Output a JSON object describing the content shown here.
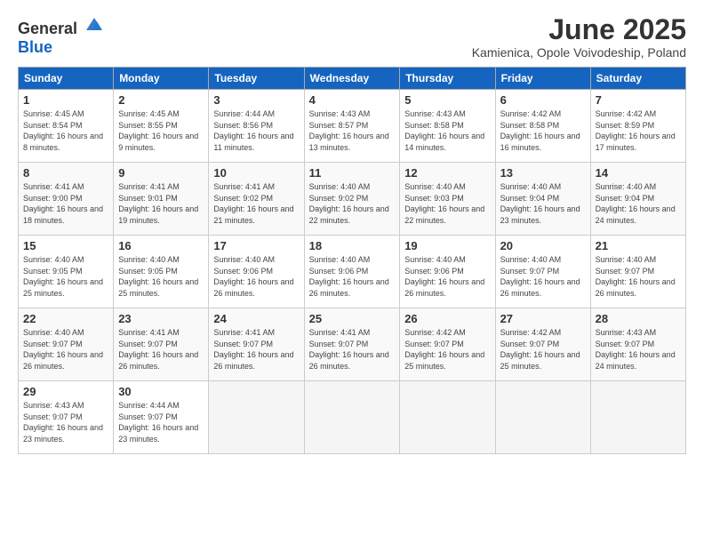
{
  "logo": {
    "general": "General",
    "blue": "Blue"
  },
  "header": {
    "month": "June 2025",
    "location": "Kamienica, Opole Voivodeship, Poland"
  },
  "weekdays": [
    "Sunday",
    "Monday",
    "Tuesday",
    "Wednesday",
    "Thursday",
    "Friday",
    "Saturday"
  ],
  "weeks": [
    [
      {
        "day": "1",
        "sunrise": "4:45 AM",
        "sunset": "8:54 PM",
        "daylight": "16 hours and 8 minutes."
      },
      {
        "day": "2",
        "sunrise": "4:45 AM",
        "sunset": "8:55 PM",
        "daylight": "16 hours and 9 minutes."
      },
      {
        "day": "3",
        "sunrise": "4:44 AM",
        "sunset": "8:56 PM",
        "daylight": "16 hours and 11 minutes."
      },
      {
        "day": "4",
        "sunrise": "4:43 AM",
        "sunset": "8:57 PM",
        "daylight": "16 hours and 13 minutes."
      },
      {
        "day": "5",
        "sunrise": "4:43 AM",
        "sunset": "8:58 PM",
        "daylight": "16 hours and 14 minutes."
      },
      {
        "day": "6",
        "sunrise": "4:42 AM",
        "sunset": "8:58 PM",
        "daylight": "16 hours and 16 minutes."
      },
      {
        "day": "7",
        "sunrise": "4:42 AM",
        "sunset": "8:59 PM",
        "daylight": "16 hours and 17 minutes."
      }
    ],
    [
      {
        "day": "8",
        "sunrise": "4:41 AM",
        "sunset": "9:00 PM",
        "daylight": "16 hours and 18 minutes."
      },
      {
        "day": "9",
        "sunrise": "4:41 AM",
        "sunset": "9:01 PM",
        "daylight": "16 hours and 19 minutes."
      },
      {
        "day": "10",
        "sunrise": "4:41 AM",
        "sunset": "9:02 PM",
        "daylight": "16 hours and 21 minutes."
      },
      {
        "day": "11",
        "sunrise": "4:40 AM",
        "sunset": "9:02 PM",
        "daylight": "16 hours and 22 minutes."
      },
      {
        "day": "12",
        "sunrise": "4:40 AM",
        "sunset": "9:03 PM",
        "daylight": "16 hours and 22 minutes."
      },
      {
        "day": "13",
        "sunrise": "4:40 AM",
        "sunset": "9:04 PM",
        "daylight": "16 hours and 23 minutes."
      },
      {
        "day": "14",
        "sunrise": "4:40 AM",
        "sunset": "9:04 PM",
        "daylight": "16 hours and 24 minutes."
      }
    ],
    [
      {
        "day": "15",
        "sunrise": "4:40 AM",
        "sunset": "9:05 PM",
        "daylight": "16 hours and 25 minutes."
      },
      {
        "day": "16",
        "sunrise": "4:40 AM",
        "sunset": "9:05 PM",
        "daylight": "16 hours and 25 minutes."
      },
      {
        "day": "17",
        "sunrise": "4:40 AM",
        "sunset": "9:06 PM",
        "daylight": "16 hours and 26 minutes."
      },
      {
        "day": "18",
        "sunrise": "4:40 AM",
        "sunset": "9:06 PM",
        "daylight": "16 hours and 26 minutes."
      },
      {
        "day": "19",
        "sunrise": "4:40 AM",
        "sunset": "9:06 PM",
        "daylight": "16 hours and 26 minutes."
      },
      {
        "day": "20",
        "sunrise": "4:40 AM",
        "sunset": "9:07 PM",
        "daylight": "16 hours and 26 minutes."
      },
      {
        "day": "21",
        "sunrise": "4:40 AM",
        "sunset": "9:07 PM",
        "daylight": "16 hours and 26 minutes."
      }
    ],
    [
      {
        "day": "22",
        "sunrise": "4:40 AM",
        "sunset": "9:07 PM",
        "daylight": "16 hours and 26 minutes."
      },
      {
        "day": "23",
        "sunrise": "4:41 AM",
        "sunset": "9:07 PM",
        "daylight": "16 hours and 26 minutes."
      },
      {
        "day": "24",
        "sunrise": "4:41 AM",
        "sunset": "9:07 PM",
        "daylight": "16 hours and 26 minutes."
      },
      {
        "day": "25",
        "sunrise": "4:41 AM",
        "sunset": "9:07 PM",
        "daylight": "16 hours and 26 minutes."
      },
      {
        "day": "26",
        "sunrise": "4:42 AM",
        "sunset": "9:07 PM",
        "daylight": "16 hours and 25 minutes."
      },
      {
        "day": "27",
        "sunrise": "4:42 AM",
        "sunset": "9:07 PM",
        "daylight": "16 hours and 25 minutes."
      },
      {
        "day": "28",
        "sunrise": "4:43 AM",
        "sunset": "9:07 PM",
        "daylight": "16 hours and 24 minutes."
      }
    ],
    [
      {
        "day": "29",
        "sunrise": "4:43 AM",
        "sunset": "9:07 PM",
        "daylight": "16 hours and 23 minutes."
      },
      {
        "day": "30",
        "sunrise": "4:44 AM",
        "sunset": "9:07 PM",
        "daylight": "16 hours and 23 minutes."
      },
      null,
      null,
      null,
      null,
      null
    ]
  ]
}
